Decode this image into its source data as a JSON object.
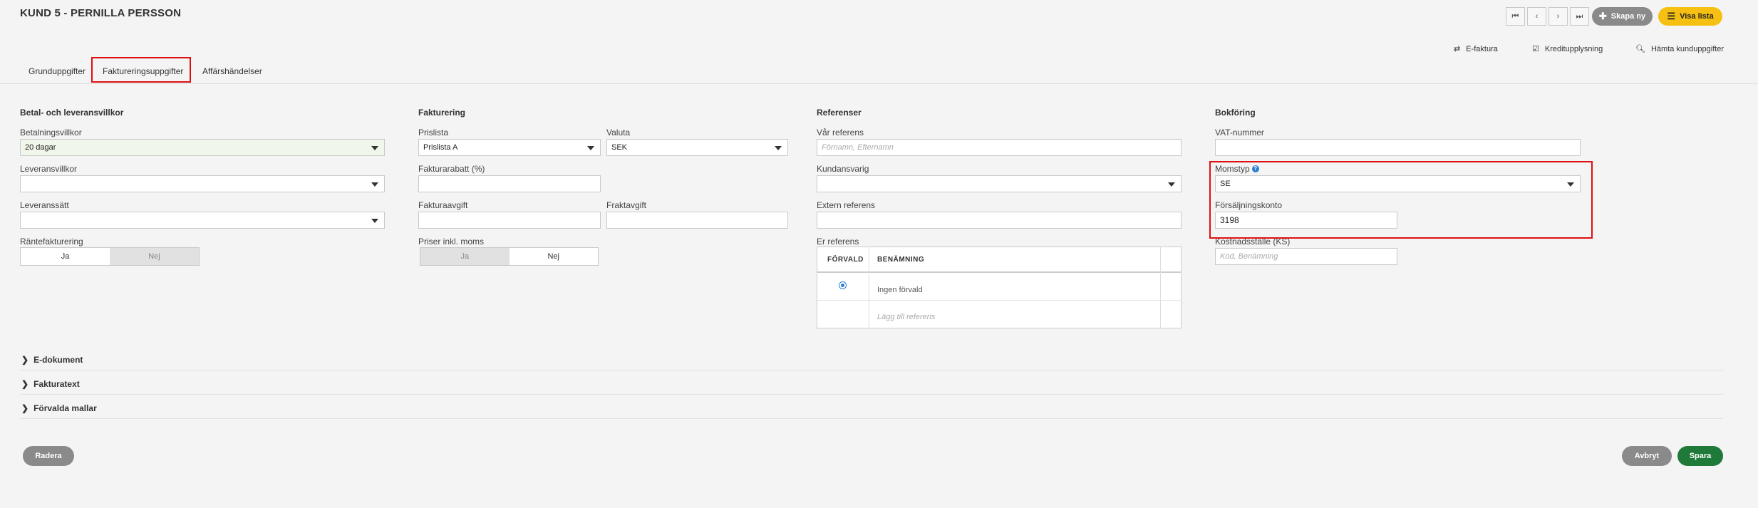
{
  "header": {
    "title": "KUND 5 - PERNILLA PERSSON",
    "create_new_label": "Skapa ny",
    "show_list_label": "Visa lista"
  },
  "toplinks": {
    "efaktura": "E-faktura",
    "kreditupplysning": "Kreditupplysning",
    "hamta": "Hämta kunduppgifter"
  },
  "tabs": [
    "Grunduppgifter",
    "Faktureringsuppgifter",
    "Affärshändelser"
  ],
  "betal": {
    "heading": "Betal- och leveransvillkor",
    "betalningsvillkor_label": "Betalningsvillkor",
    "betalningsvillkor_value": "20 dagar",
    "leveransvillkor_label": "Leveransvillkor",
    "leveranssatt_label": "Leveranssätt",
    "rante_label": "Räntefakturering",
    "ja": "Ja",
    "nej": "Nej"
  },
  "fakturering": {
    "heading": "Fakturering",
    "prislista_label": "Prislista",
    "prislista_value": "Prislista A",
    "valuta_label": "Valuta",
    "valuta_value": "SEK",
    "rabatt_label": "Fakturarabatt (%)",
    "avgift_label": "Fakturaavgift",
    "frakt_label": "Fraktavgift",
    "moms_label": "Priser inkl. moms",
    "ja": "Ja",
    "nej": "Nej"
  },
  "referenser": {
    "heading": "Referenser",
    "var_label": "Vår referens",
    "var_placeholder": "Förnamn, Efternamn",
    "kundansvarig_label": "Kundansvarig",
    "extern_label": "Extern referens",
    "er_label": "Er referens",
    "col_forvald": "FÖRVALD",
    "col_benamning": "BENÄMNING",
    "row1": "Ingen förvald",
    "row2_placeholder": "Lägg till referens"
  },
  "bokforing": {
    "heading": "Bokföring",
    "vat_label": "VAT-nummer",
    "momstyp_label": "Momstyp",
    "momstyp_value": "SE",
    "forsaljning_label": "Försäljningskonto",
    "forsaljning_value": "3198",
    "kostnad_label": "Kostnadsställe (KS)",
    "kostnad_placeholder": "Kod, Benämning"
  },
  "collapsibles": [
    "E-dokument",
    "Fakturatext",
    "Förvalda mallar"
  ],
  "footer": {
    "delete_label": "Radera",
    "cancel_label": "Avbryt",
    "save_label": "Spara"
  },
  "colors": {
    "accent_yellow": "#f6c012",
    "save_green": "#1f7a3a",
    "highlight_red": "#dd1111",
    "info_blue": "#2a7fd4"
  }
}
